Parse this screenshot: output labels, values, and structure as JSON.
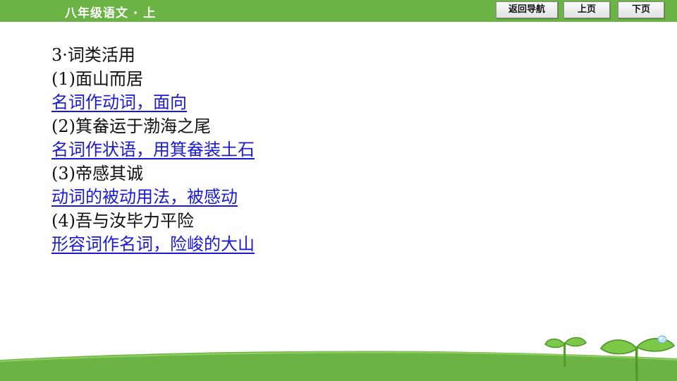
{
  "header": {
    "title": "八年级语文 · 上",
    "nav": {
      "back_label": "返回导航",
      "prev_label": "上页",
      "next_label": "下页"
    }
  },
  "content": {
    "lines": [
      {
        "text": "3·词类活用",
        "kind": "question"
      },
      {
        "text": "(1)面山而居",
        "kind": "question"
      },
      {
        "text": "名词作动词，面向",
        "kind": "answer"
      },
      {
        "text": "(2)箕畚运于渤海之尾",
        "kind": "question"
      },
      {
        "text": "名词作状语，用箕畚装土石",
        "kind": "answer"
      },
      {
        "text": "(3)帝感其诚",
        "kind": "question"
      },
      {
        "text": "动词的被动用法，被感动",
        "kind": "answer"
      },
      {
        "text": "(4)吾与汝毕力平险",
        "kind": "question"
      },
      {
        "text": "形容词作名词，险峻的大山",
        "kind": "answer"
      }
    ]
  },
  "colors": {
    "header_green": "#6ab344",
    "answer_blue": "#1a1ad6",
    "ground_green": "#6ab344"
  },
  "icons": [
    "sprout-icon",
    "sprout-with-droplet-icon"
  ]
}
